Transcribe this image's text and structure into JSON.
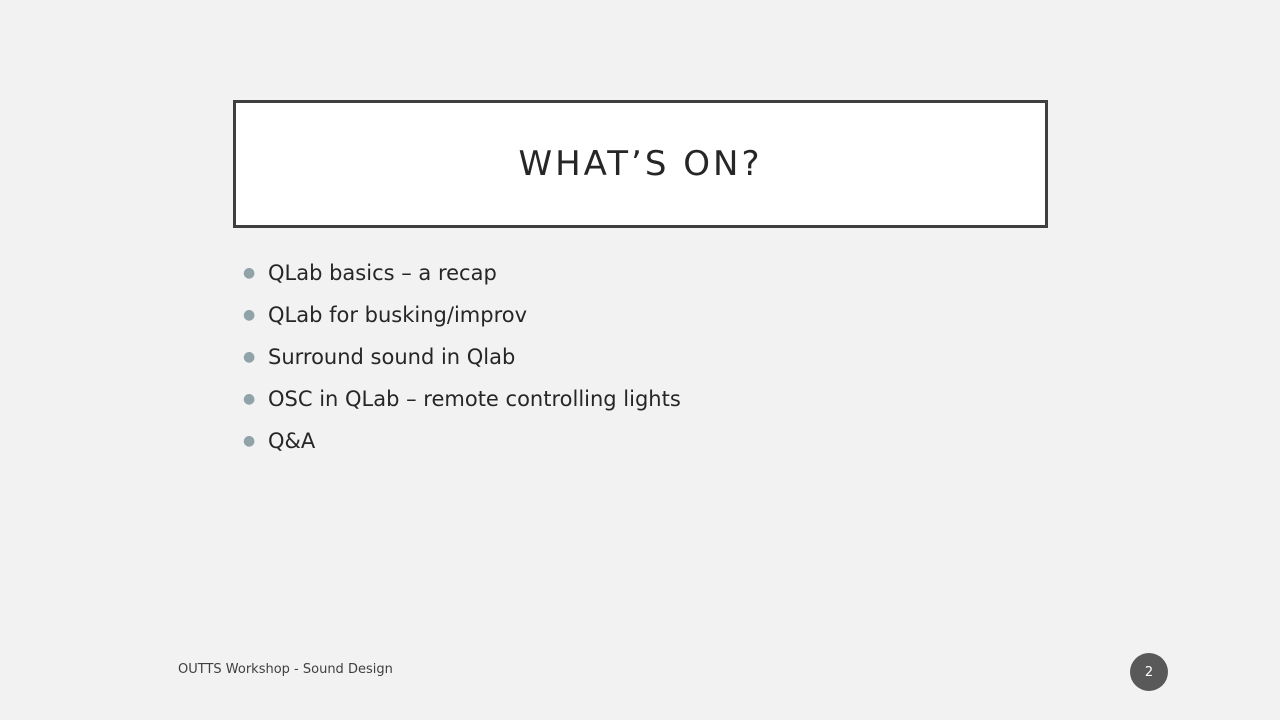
{
  "slide": {
    "title": "WHAT’S ON?",
    "bullets": [
      "QLab basics – a recap",
      "QLab for busking/improv",
      "Surround sound in Qlab",
      "OSC in QLab – remote controlling lights",
      "Q&A"
    ],
    "footer": "OUTTS Workshop - Sound Design",
    "page_number": "2"
  },
  "colors": {
    "background": "#f2f2f2",
    "title_box_border": "#3f3f3f",
    "bullet_marker": "#8fa3a8",
    "page_badge": "#595959"
  }
}
